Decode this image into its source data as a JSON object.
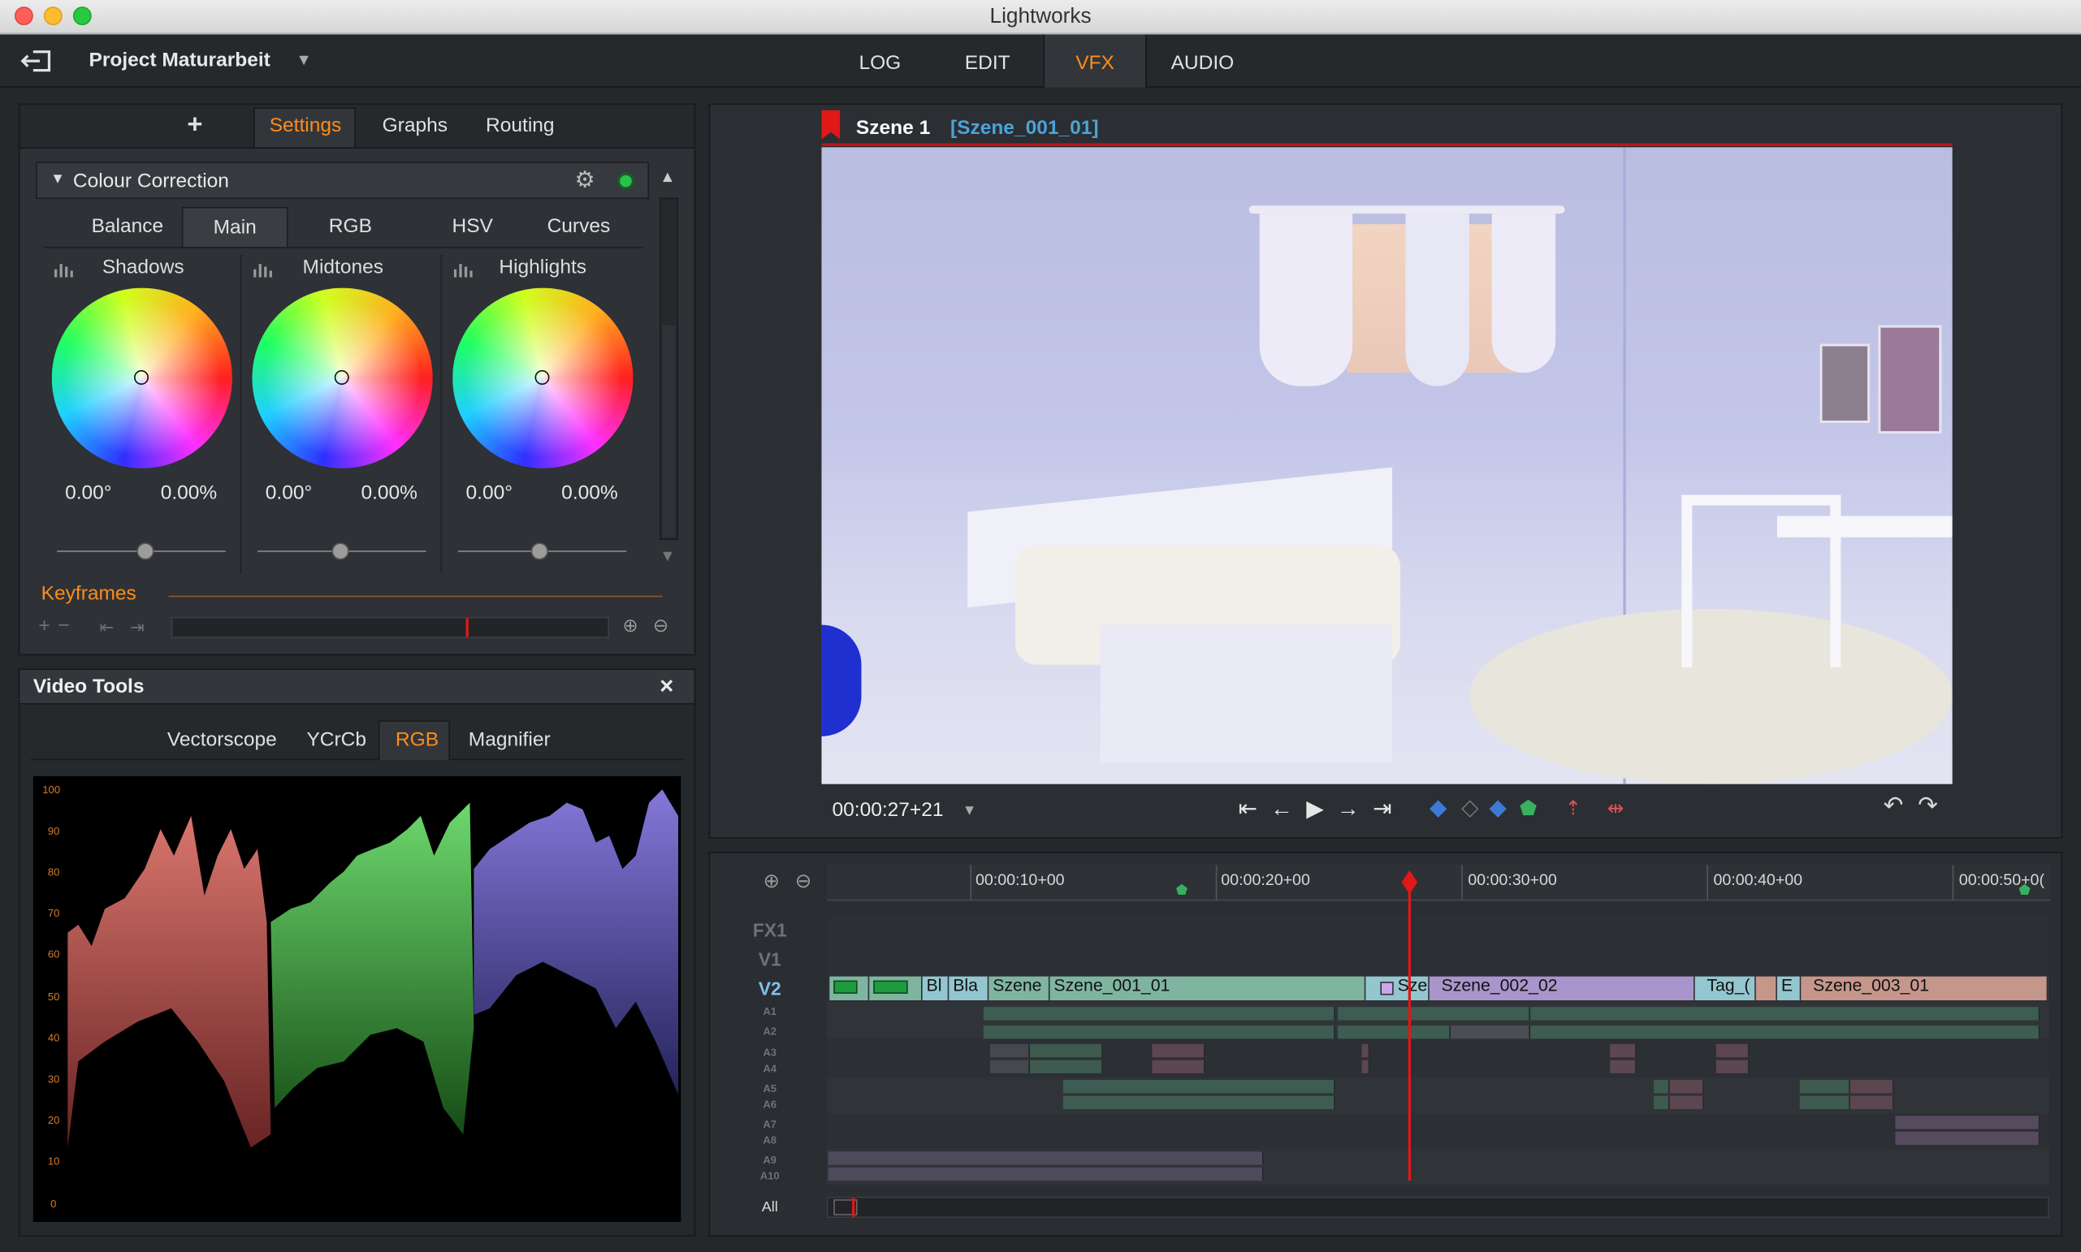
{
  "window": {
    "title": "Lightworks"
  },
  "project": {
    "name": "Project Maturarbeit"
  },
  "menu": {
    "tabs": [
      "LOG",
      "EDIT",
      "VFX",
      "AUDIO"
    ],
    "active": "VFX"
  },
  "effects_panel": {
    "add_label": "+",
    "tabs": [
      "Settings",
      "Graphs",
      "Routing"
    ],
    "active_tab": "Settings"
  },
  "colour_correction": {
    "title": "Colour Correction",
    "tabs": [
      "Balance",
      "Main",
      "RGB",
      "HSV",
      "Curves"
    ],
    "active_tab": "Main",
    "wheels": [
      {
        "label": "Shadows",
        "hue": "0.00°",
        "sat": "0.00%"
      },
      {
        "label": "Midtones",
        "hue": "0.00°",
        "sat": "0.00%"
      },
      {
        "label": "Highlights",
        "hue": "0.00°",
        "sat": "0.00%"
      }
    ],
    "keyframes_label": "Keyframes"
  },
  "video_tools": {
    "title": "Video Tools",
    "close": "×",
    "tabs": [
      "Vectorscope",
      "YCrCb",
      "RGB",
      "Magnifier"
    ],
    "active_tab": "RGB",
    "scale": [
      "100",
      "90",
      "80",
      "70",
      "60",
      "50",
      "40",
      "30",
      "20",
      "10",
      "0"
    ]
  },
  "viewer": {
    "scene": "Szene 1",
    "clip": "[Szene_001_01]",
    "timecode": "00:00:27+21"
  },
  "timeline": {
    "ticks": [
      "00:00:10+00",
      "00:00:20+00",
      "00:00:30+00",
      "00:00:40+00",
      "00:00:50+0("
    ],
    "tracks": [
      "FX1",
      "V1",
      "V2"
    ],
    "audio_tracks": [
      "A1",
      "A2",
      "A3",
      "A4",
      "A5",
      "A6",
      "A7",
      "A8",
      "A9",
      "A10"
    ],
    "all_label": "All",
    "clips": [
      "Bl",
      "Bla",
      "Szene",
      "Szene_001_01",
      "Sze",
      "Szene_002_02",
      "Tag_(",
      "E",
      "Szene_003_01"
    ]
  },
  "colors": {
    "accent": "#ff8c1a",
    "playhead": "#e01818",
    "v_clip": "#7fb5a0",
    "purple_clip": "#a995cc",
    "brown_clip": "#c5968a"
  }
}
